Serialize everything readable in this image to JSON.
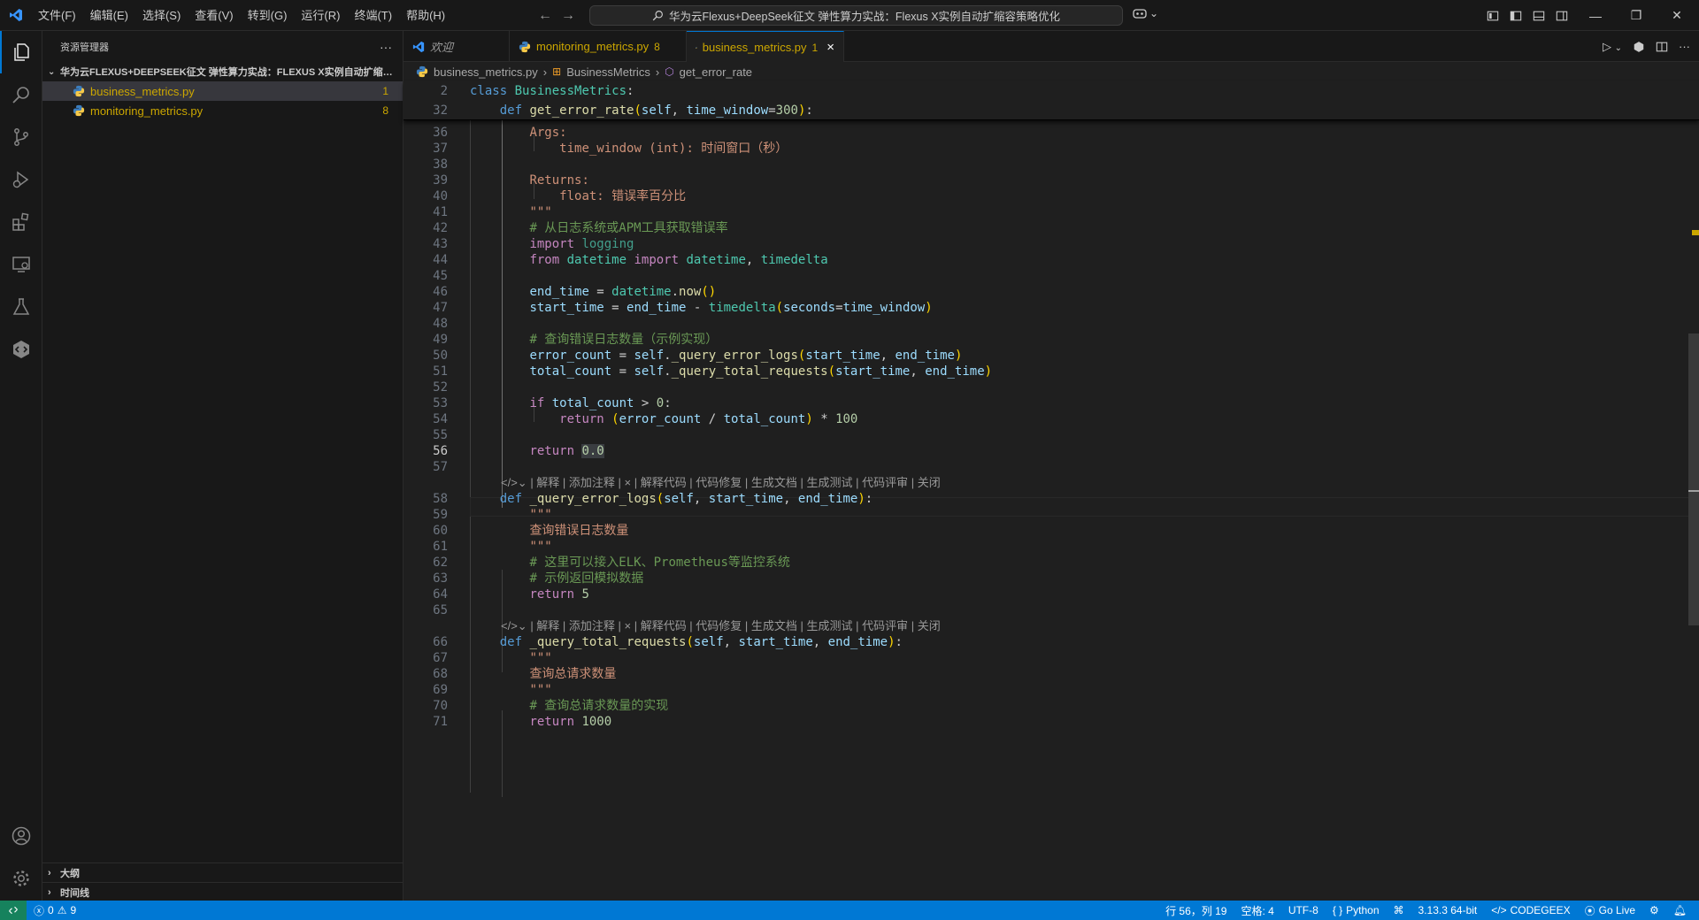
{
  "menu": [
    "文件(F)",
    "编辑(E)",
    "选择(S)",
    "查看(V)",
    "转到(G)",
    "运行(R)",
    "终端(T)",
    "帮助(H)"
  ],
  "search_title": "华为云Flexus+DeepSeek征文 弹性算力实战：Flexus X实例自动扩缩容策略优化",
  "sidebar": {
    "title": "资源管理器",
    "more": "···",
    "folder": "华为云FLEXUS+DEEPSEEK征文 弹性算力实战：FLEXUS X实例自动扩缩容策略优化",
    "files": [
      {
        "name": "business_metrics.py",
        "badge": "1"
      },
      {
        "name": "monitoring_metrics.py",
        "badge": "8"
      }
    ],
    "outline": "大纲",
    "timeline": "时间线"
  },
  "tabs": [
    {
      "label": "欢迎",
      "badge": ""
    },
    {
      "label": "monitoring_metrics.py",
      "badge": "8"
    },
    {
      "label": "business_metrics.py",
      "badge": "1"
    }
  ],
  "tab_close": "×",
  "breadcrumb": {
    "file": "business_metrics.py",
    "cls": "BusinessMetrics",
    "method": "get_error_rate",
    "sep": "›"
  },
  "code": {
    "sticky": [
      {
        "n": "2"
      },
      {
        "n": "32"
      }
    ],
    "lines": [
      {
        "n": "36"
      },
      {
        "n": "37"
      },
      {
        "n": "38"
      },
      {
        "n": "39"
      },
      {
        "n": "40"
      },
      {
        "n": "41"
      },
      {
        "n": "42"
      },
      {
        "n": "43"
      },
      {
        "n": "44"
      },
      {
        "n": "45"
      },
      {
        "n": "46"
      },
      {
        "n": "47"
      },
      {
        "n": "48"
      },
      {
        "n": "49"
      },
      {
        "n": "50"
      },
      {
        "n": "51"
      },
      {
        "n": "52"
      },
      {
        "n": "53"
      },
      {
        "n": "54"
      },
      {
        "n": "55"
      },
      {
        "n": "56"
      },
      {
        "n": "57"
      },
      {
        "n": "58"
      },
      {
        "n": "59"
      },
      {
        "n": "60"
      },
      {
        "n": "61"
      },
      {
        "n": "62"
      },
      {
        "n": "63"
      },
      {
        "n": "64"
      },
      {
        "n": "65"
      },
      {
        "n": "66"
      },
      {
        "n": "67"
      },
      {
        "n": "68"
      },
      {
        "n": "69"
      },
      {
        "n": "70"
      },
      {
        "n": "71"
      }
    ],
    "codelens": "| 解释 | 添加注释 | × | 解释代码 | 代码修复 | 生成文档 | 生成测试 | 代码评审 | 关闭"
  },
  "status": {
    "errors": "0",
    "warnings": "9",
    "position": "行 56，列 19",
    "spaces": "空格: 4",
    "encoding": "UTF-8",
    "language": "Python",
    "interpreter": "3.13.3 64-bit",
    "codegeex": "CODEGEEX",
    "golive": "Go Live"
  },
  "colors": {
    "accent": "#0078d4",
    "status_bg": "#0078d4",
    "warning_file": "#cca700"
  }
}
